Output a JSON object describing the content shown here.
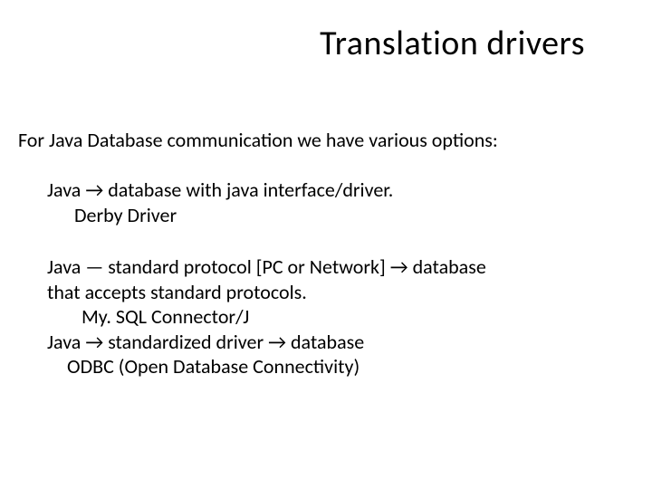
{
  "title": "Translation drivers",
  "intro": "For Java Database communication we have various options:",
  "block1": {
    "line1": "Java → database with java interface/driver.",
    "line2": "Derby Driver"
  },
  "block2": {
    "line1": "Java — standard protocol [PC or Network] → database",
    "line2": "that accepts standard protocols.",
    "line3": "My. SQL Connector/J",
    "line4": "Java → standardized driver → database",
    "line5": "ODBC (Open Database Connectivity)"
  }
}
